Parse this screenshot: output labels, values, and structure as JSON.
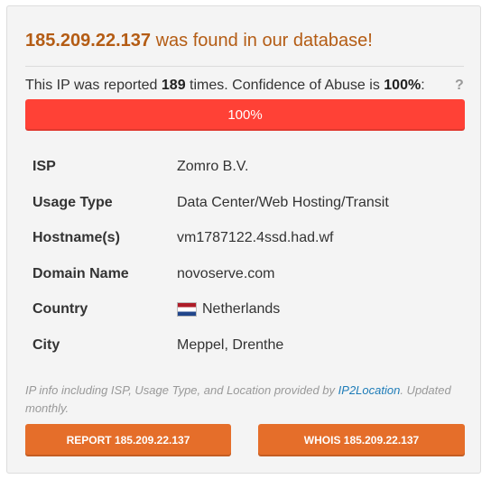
{
  "header": {
    "ip": "185.209.22.137",
    "found_text": " was found in our database!"
  },
  "report_summary": {
    "prefix": "This IP was reported ",
    "count": "189",
    "middle": " times. Confidence of Abuse is ",
    "confidence": "100%",
    "suffix": ":",
    "help": "?"
  },
  "confidence_bar": {
    "label": "100%",
    "fraction": 1.0,
    "color": "#ff4136"
  },
  "details": [
    {
      "key": "ISP",
      "value": "Zomro B.V."
    },
    {
      "key": "Usage Type",
      "value": "Data Center/Web Hosting/Transit"
    },
    {
      "key": "Hostname(s)",
      "value": "vm1787122.4ssd.had.wf"
    },
    {
      "key": "Domain Name",
      "value": "novoserve.com"
    },
    {
      "key": "Country",
      "value": "Netherlands",
      "icon": "netherlands-flag-icon"
    },
    {
      "key": "City",
      "value": "Meppel, Drenthe"
    }
  ],
  "note": {
    "prefix": "IP info including ISP, Usage Type, and Location provided by ",
    "link": "IP2Location",
    "suffix": ". Updated monthly."
  },
  "buttons": {
    "report": "REPORT 185.209.22.137",
    "whois": "WHOIS 185.209.22.137"
  },
  "colors": {
    "accent": "#e56e2a",
    "headline": "#b45c14",
    "link": "#1e7cb8"
  }
}
